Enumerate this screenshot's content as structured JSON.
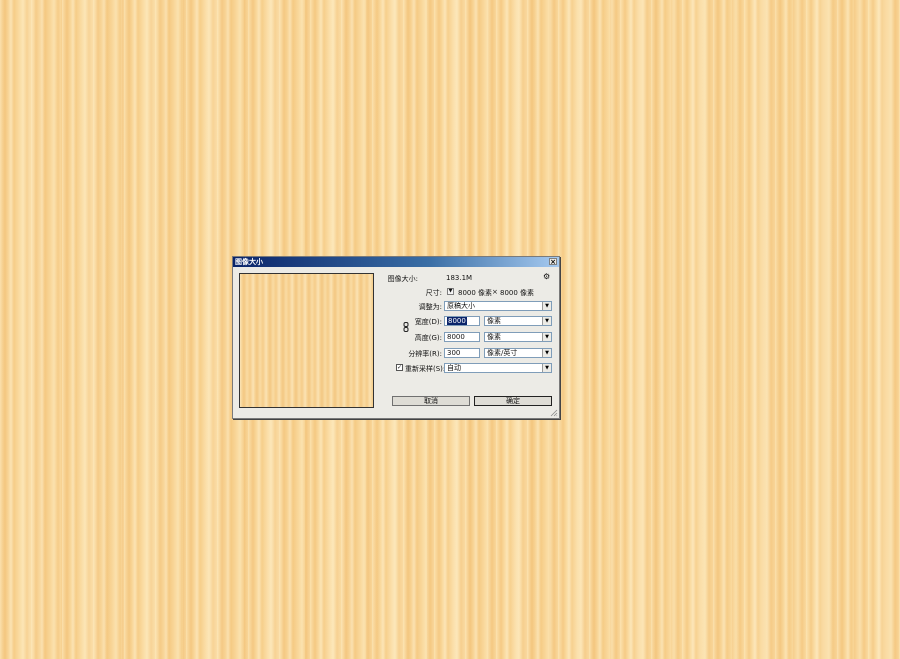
{
  "dialog": {
    "title": "图像大小",
    "close_label": "×"
  },
  "info": {
    "image_size_label": "图像大小:",
    "image_size_value": "183.1M",
    "dimensions_label": "尺寸:",
    "dimensions_width": "8000 像素",
    "dimensions_times": "×",
    "dimensions_height": "8000 像素"
  },
  "fit_to": {
    "label": "调整为:",
    "value": "原稿大小"
  },
  "width": {
    "label": "宽度(D):",
    "value": "8000",
    "unit": "像素"
  },
  "height": {
    "label": "高度(G):",
    "value": "8000",
    "unit": "像素"
  },
  "resolution": {
    "label": "分辨率(R):",
    "value": "300",
    "unit": "像素/英寸"
  },
  "resample": {
    "checked": true,
    "check_mark": "✓",
    "label": "重新采样(S):",
    "value": "自动"
  },
  "buttons": {
    "cancel": "取消",
    "ok": "确定"
  },
  "icons": {
    "gear": "⚙",
    "dropdown_arrow": "▼"
  }
}
